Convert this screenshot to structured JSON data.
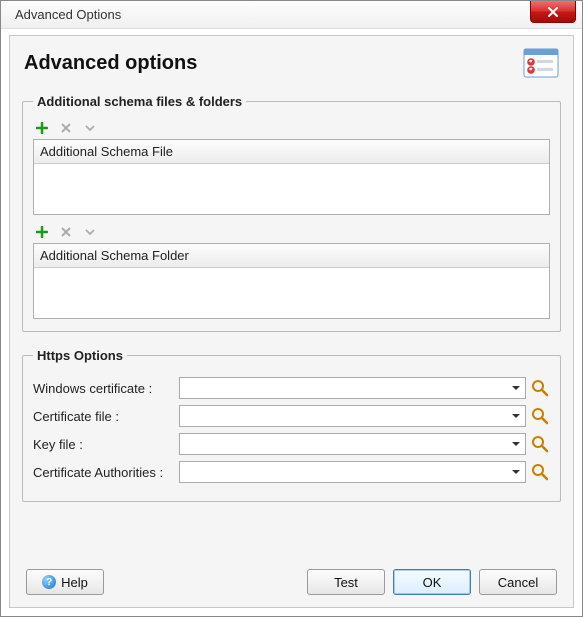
{
  "window": {
    "title": "Advanced Options"
  },
  "header": {
    "title": "Advanced options"
  },
  "groups": {
    "schema": {
      "legend": "Additional schema files & folders",
      "file_list_header": "Additional Schema File",
      "folder_list_header": "Additional Schema Folder"
    },
    "https": {
      "legend": "Https Options",
      "rows": {
        "win_cert": {
          "label": "Windows certificate :",
          "value": ""
        },
        "cert_file": {
          "label": "Certificate file :",
          "value": ""
        },
        "key_file": {
          "label": "Key file :",
          "value": ""
        },
        "cert_auth": {
          "label": "Certificate Authorities :",
          "value": ""
        }
      }
    }
  },
  "buttons": {
    "help": "Help",
    "test": "Test",
    "ok": "OK",
    "cancel": "Cancel"
  }
}
